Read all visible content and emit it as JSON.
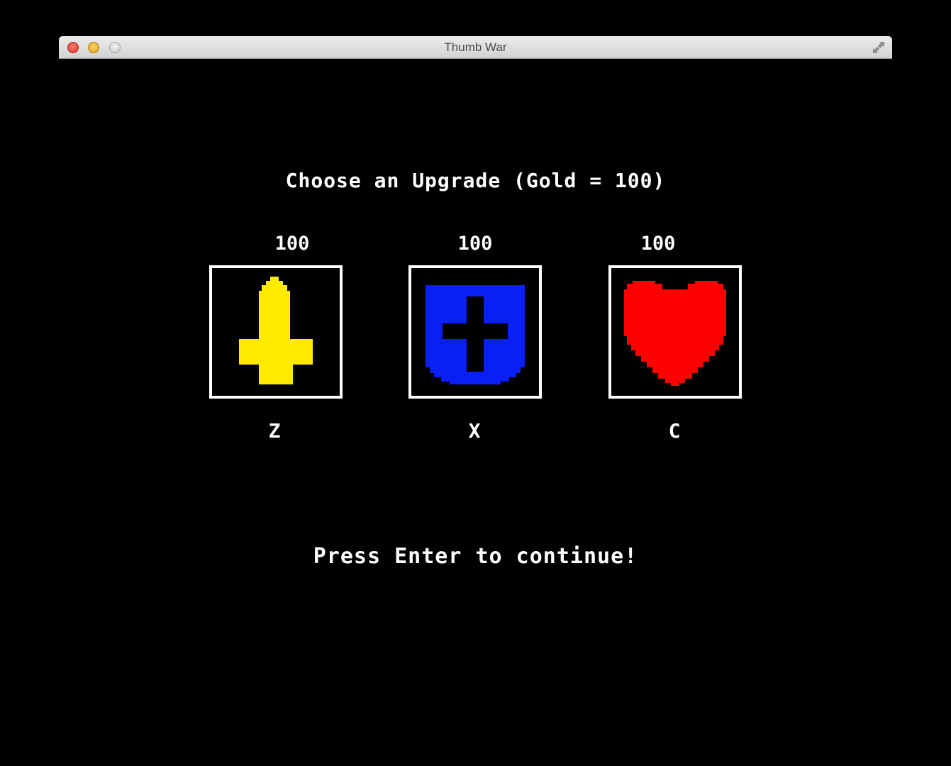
{
  "window": {
    "title": "Thumb War"
  },
  "screen": {
    "heading": "Choose an Upgrade (Gold = 100)",
    "prompt": "Press Enter to continue!"
  },
  "upgrades": [
    {
      "cost": "100",
      "key": "Z",
      "icon": "sword-icon",
      "color": "#ffea00"
    },
    {
      "cost": "100",
      "key": "X",
      "icon": "shield-icon",
      "color": "#0a1ff5"
    },
    {
      "cost": "100",
      "key": "C",
      "icon": "heart-icon",
      "color": "#ff0000"
    }
  ],
  "colors": {
    "background": "#000000",
    "text": "#ffffff",
    "frame": "#ffffff"
  }
}
